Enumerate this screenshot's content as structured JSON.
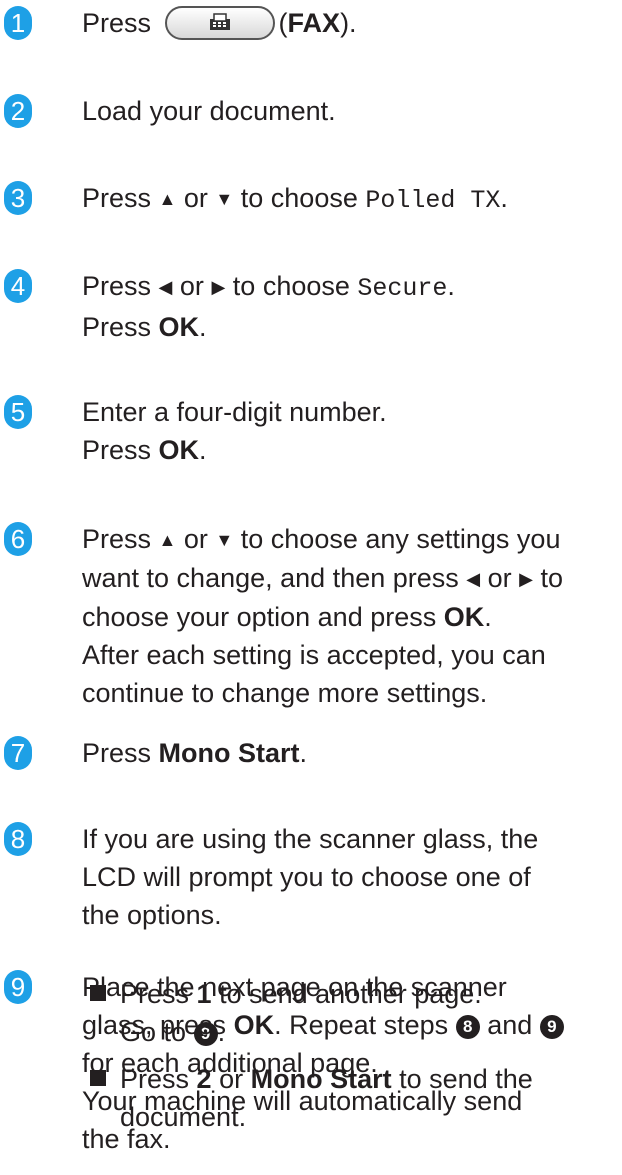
{
  "steps": [
    {
      "num": "1",
      "press": "Press",
      "fax_label": "FAX",
      "open": "(",
      "close": ")."
    },
    {
      "num": "2",
      "text": "Load your document."
    },
    {
      "num": "3",
      "a": "Press",
      "up": "▲",
      "or": "or",
      "down": "▼",
      "b": "to choose",
      "mono": "Polled TX",
      "end": "."
    },
    {
      "num": "4",
      "a": "Press",
      "left": "◀",
      "or": "or",
      "right": "▶",
      "b": "to choose",
      "mono": "Secure",
      "end": ".",
      "press2": "Press",
      "ok": "OK",
      "end2": "."
    },
    {
      "num": "5",
      "line1": "Enter a four-digit number.",
      "press2": "Press",
      "ok": "OK",
      "end2": "."
    },
    {
      "num": "6",
      "l1a": "Press",
      "up": "▲",
      "or": "or",
      "down": "▼",
      "l1b": "to choose any settings you",
      "l2a": "want to change, and then press",
      "left": "◀",
      "or2": "or",
      "right": "▶",
      "l2b": "to",
      "l3a": "choose your option and press",
      "ok": "OK",
      "end": ".",
      "l4": "After each setting is accepted, you can",
      "l5": "continue to change more settings."
    },
    {
      "num": "7",
      "press": "Press",
      "bold": "Mono Start",
      "end": "."
    },
    {
      "num": "8",
      "l1": "If you are using the scanner glass, the",
      "l2": "LCD will prompt you to choose one of",
      "l3": "the options.",
      "b1a": "Press",
      "b1k": "1",
      "b1b": "to send another page.",
      "b1c": "Go to",
      "b1ref": "9",
      "b1end": ".",
      "b2a": "Press",
      "b2k": "2",
      "b2or": "or",
      "b2bold": "Mono Start",
      "b2b": "to send the",
      "b2c": "document."
    },
    {
      "num": "9",
      "l1": "Place the next page on the scanner",
      "l2a": "glass, press",
      "ok": "OK",
      "l2b": ". Repeat steps",
      "ref8": "8",
      "and": "and",
      "ref9": "9",
      "l3": "for each additional page.",
      "l4": "Your machine will automatically send",
      "l5": "the fax."
    }
  ],
  "colors": {
    "step_badge": "#1ea0e6",
    "text": "#231f20"
  },
  "icons": {
    "fax_button": "fax-icon"
  }
}
